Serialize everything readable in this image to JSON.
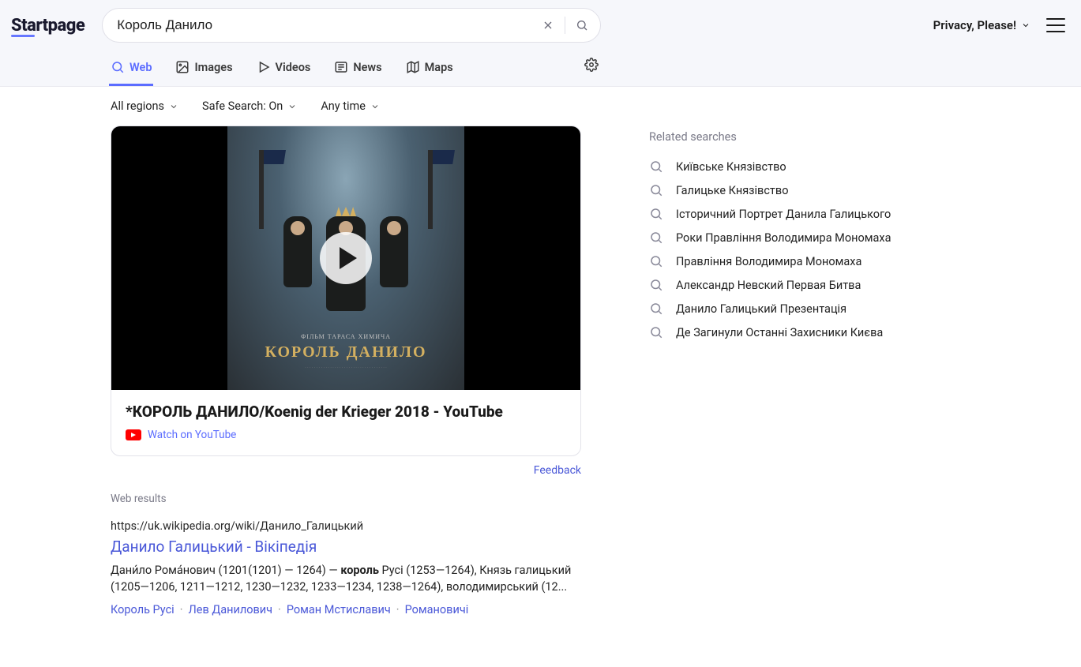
{
  "logo_text": "Startpage",
  "search": {
    "value": "Король Данило",
    "placeholder": ""
  },
  "privacy_label": "Privacy, Please!",
  "tabs": {
    "web": "Web",
    "images": "Images",
    "videos": "Videos",
    "news": "News",
    "maps": "Maps"
  },
  "filters": {
    "region": "All regions",
    "safesearch": "Safe Search: On",
    "time": "Any time"
  },
  "video_card": {
    "poster_subtitle": "ФІЛЬМ ТАРАСА ХИМИЧА",
    "poster_title": "КОРОЛЬ ДАНИЛО",
    "title": "*КОРОЛЬ ДАНИЛО/Koenig der Krieger 2018 - YouTube",
    "watch_label": "Watch on YouTube"
  },
  "feedback_label": "Feedback",
  "web_results_label": "Web results",
  "results": [
    {
      "url": "https://uk.wikipedia.org/wiki/Данило_Галицький",
      "title": "Данило Галицький - Вікіпедія",
      "snippet_pre": "Дани́ло Рома́нович (1201(1201) — 1264) — ",
      "snippet_bold": "король",
      "snippet_post": " Русі (1253—1264), Князь галицький (1205—1206, 1211—1212, 1230—1232, 1233—1234, 1238—1264), володимирський (12...",
      "links": [
        "Король Русі",
        "Лев Данилович",
        "Роман Мстиславич",
        "Романовичі"
      ]
    }
  ],
  "related": {
    "heading": "Related searches",
    "items": [
      "Київське Князівство",
      "Галицьке Князівство",
      "Історичний Портрет Данила Галицького",
      "Роки Правління Володимира Мономаха",
      "Правління Володимира Мономаха",
      "Александр Невский Первая Битва",
      "Данило Галицький Презентація",
      "Де Загинули Останні Захисники Києва"
    ]
  }
}
